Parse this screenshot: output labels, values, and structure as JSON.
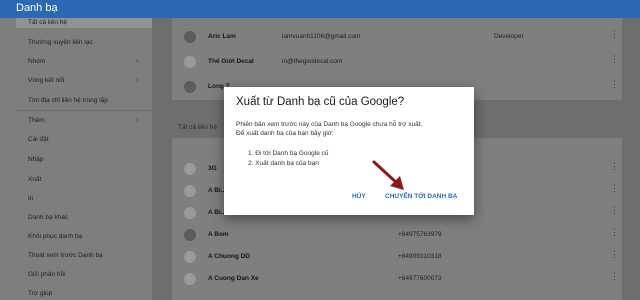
{
  "appbar": {
    "title": "Danh bạ"
  },
  "sidebar": {
    "items": [
      {
        "label": "Tất cả liên hệ",
        "active": true
      },
      {
        "label": "Thường xuyên liên lạc"
      },
      {
        "label": "Nhóm",
        "chevron": true
      },
      {
        "label": "Vòng kết nối",
        "chevron": true
      },
      {
        "label": "Tìm địa chỉ liên hệ trùng lặp"
      },
      {
        "label": "Thêm",
        "chevron": true
      },
      {
        "label": "Cài đặt"
      },
      {
        "label": "Nhập"
      },
      {
        "label": "Xuất"
      },
      {
        "label": "In"
      },
      {
        "label": "Danh bạ khác"
      },
      {
        "label": "Khôi phục danh bạ"
      },
      {
        "label": "Thoát xem trước Danh bạ"
      },
      {
        "label": "Gửi phản hồi"
      },
      {
        "label": "Trợ giúp"
      }
    ]
  },
  "contacts_top": [
    {
      "name": "Aric Lam",
      "email": "lamvuanh1106@gmail.com",
      "phone": "",
      "job": "Developer"
    },
    {
      "name": "Thế Giới Decal",
      "email": "in@thegioidecal.com",
      "phone": "",
      "job": ""
    },
    {
      "name": "Long T...",
      "email": "",
      "phone": "",
      "job": ""
    }
  ],
  "section_label": "Tất cả liên hệ",
  "contacts_bottom": [
    {
      "name": "3G",
      "phone": ""
    },
    {
      "name": "A Bi...",
      "phone": ""
    },
    {
      "name": "A Bi...",
      "phone": ""
    },
    {
      "name": "A Bi...",
      "phone": ""
    },
    {
      "name": "A Bom",
      "phone": "+84975763979"
    },
    {
      "name": "A Chuong DD",
      "phone": "+84909310318"
    },
    {
      "name": "A Cuong Dan Xe",
      "phone": "+84977600073"
    }
  ],
  "dialog": {
    "title": "Xuất từ Danh bạ cũ của Google?",
    "line1": "Phiên bản xem trước này của Danh bạ Google chưa hỗ trợ xuất.",
    "line2": "Để xuất danh bạ của bạn bây giờ:",
    "step1": "1. Đi tới Danh bạ Google cũ",
    "step2": "2. Xuất danh bạ của bạn",
    "cancel": "HỦY",
    "confirm": "CHUYỂN TỚI DANH BẠ"
  },
  "icons": {
    "more": "more-vert-icon",
    "chevron": "chevron-right-icon",
    "arrow": "red-arrow-annotation"
  },
  "colors": {
    "accent": "#2b6ab3",
    "arrow": "#8b1a1a"
  }
}
